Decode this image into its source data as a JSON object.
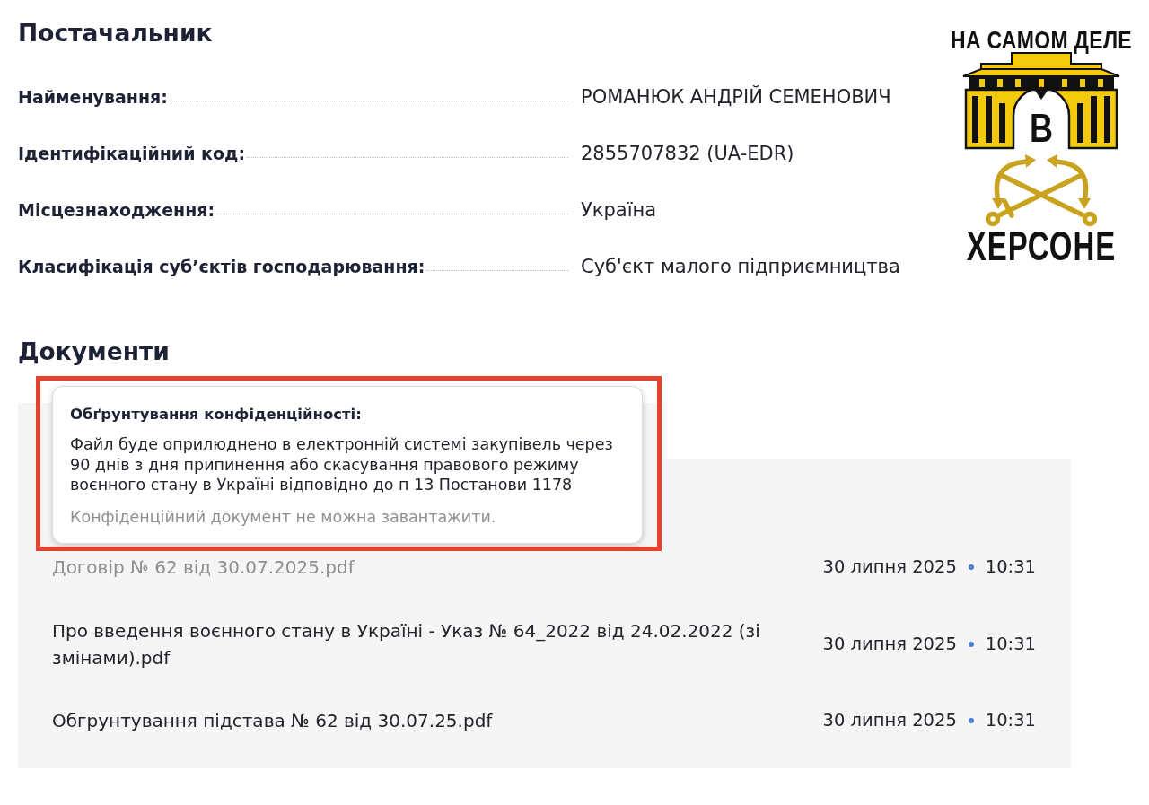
{
  "supplier": {
    "title": "Постачальник",
    "fields": [
      {
        "label": "Найменування:",
        "value": "РОМАНЮК АНДРІЙ СЕМЕНОВИЧ"
      },
      {
        "label": "Ідентифікаційний код:",
        "value": "2855707832 (UA-EDR)"
      },
      {
        "label": "Місцезнаходження:",
        "value": "Україна"
      },
      {
        "label": "Класифікація суб’єктів господарювання:",
        "value": "Суб'єкт малого підприємництва"
      }
    ]
  },
  "logo": {
    "top_text": "НА САМОМ ДЕЛЕ",
    "center_letter": "В",
    "bottom_text": "ХЕРСОНЕ"
  },
  "documents": {
    "title": "Документи",
    "tooltip": {
      "title": "Обґрунтування конфіденційності:",
      "text": "Файл буде оприлюднено в електронній системі закупівель через 90 днів з дня припинення або скасування правового режиму воєнного стану в Україні відповідно до п 13 Постанови 1178",
      "note": "Конфіденційний документ не можна завантажити."
    },
    "files": [
      {
        "name": "Договір № 62 від 30.07.2025.pdf",
        "disabled": true,
        "date": "30 липня 2025",
        "time": "10:31"
      },
      {
        "name": "Про введення воєнного стану в Україні - Указ № 64_2022 від 24.02.2022 (зі змінами).pdf",
        "disabled": false,
        "date": "30 липня 2025",
        "time": "10:31"
      },
      {
        "name": "Обгрунтування підстава № 62 від 30.07.25.pdf",
        "disabled": false,
        "date": "30 липня 2025",
        "time": "10:31"
      }
    ]
  }
}
